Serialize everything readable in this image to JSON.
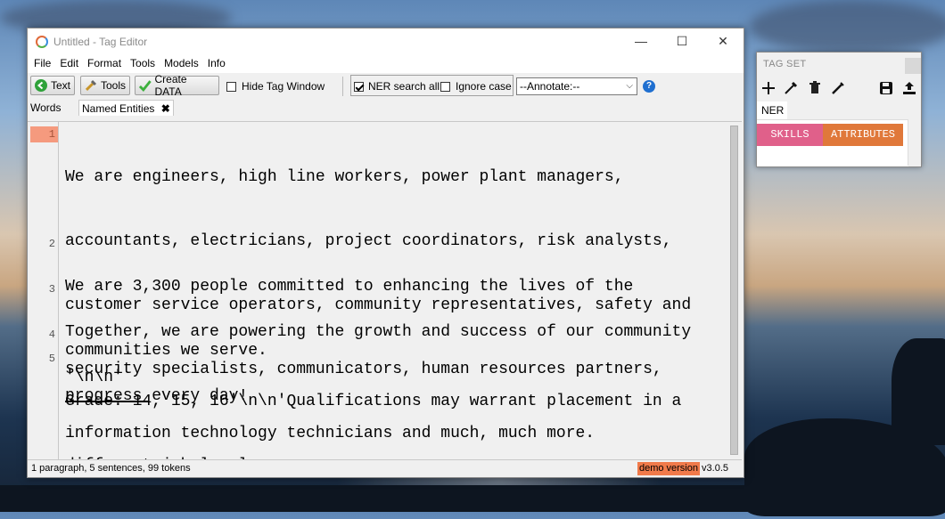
{
  "window": {
    "title": "Untitled - Tag Editor",
    "minimize": "—",
    "maximize": "☐",
    "close": "✕"
  },
  "menu": [
    "File",
    "Edit",
    "Format",
    "Tools",
    "Models",
    "Info"
  ],
  "toolbar": {
    "text_label": "Text",
    "tools_label": "Tools",
    "create_data_label": "Create DATA",
    "hide_tag_window_label": "Hide Tag Window",
    "hide_tag_window_checked": false,
    "ner_search_all_label": "NER search all",
    "ner_search_all_checked": true,
    "ignore_case_label": "Ignore case",
    "ignore_case_checked": false,
    "annotate_value": "--Annotate:--",
    "help": "?"
  },
  "tabs": [
    {
      "label": "Words",
      "close": ""
    },
    {
      "label": "Named Entities",
      "close": "✖"
    }
  ],
  "document": {
    "paragraphs": [
      {
        "num": "1",
        "lines": [
          "We are engineers, high line workers, power plant managers,",
          "accountants, electricians, project coordinators, risk analysts,",
          "customer service operators, community representatives, safety and",
          "security specialists, communicators, human resources partners,",
          "information technology technicians and much, much more."
        ]
      },
      {
        "num": "2",
        "lines": [
          "We are 3,300 people committed to enhancing the lives of the",
          "communities we serve."
        ]
      },
      {
        "num": "3",
        "lines": [
          "Together, we are powering the growth and success of our community",
          "progress every day!"
        ]
      },
      {
        "num": "4",
        "lines": [
          "'\\n\\n'"
        ]
      },
      {
        "num": "5",
        "lines": [
          "Grade: 14, 15, 16'\\n\\n'Qualifications may warrant placement in a",
          "different job level."
        ]
      }
    ]
  },
  "status": {
    "summary": "1 paragraph, 5 sentences, 99 tokens",
    "demo": "demo version",
    "version": "v3.0.5"
  },
  "tag_set": {
    "title": "TAG SET",
    "tab": "NER",
    "tags": [
      {
        "label": "SKILLS",
        "color": "#e0608a"
      },
      {
        "label": "ATTRIBUTES",
        "color": "#e0783a"
      }
    ]
  }
}
